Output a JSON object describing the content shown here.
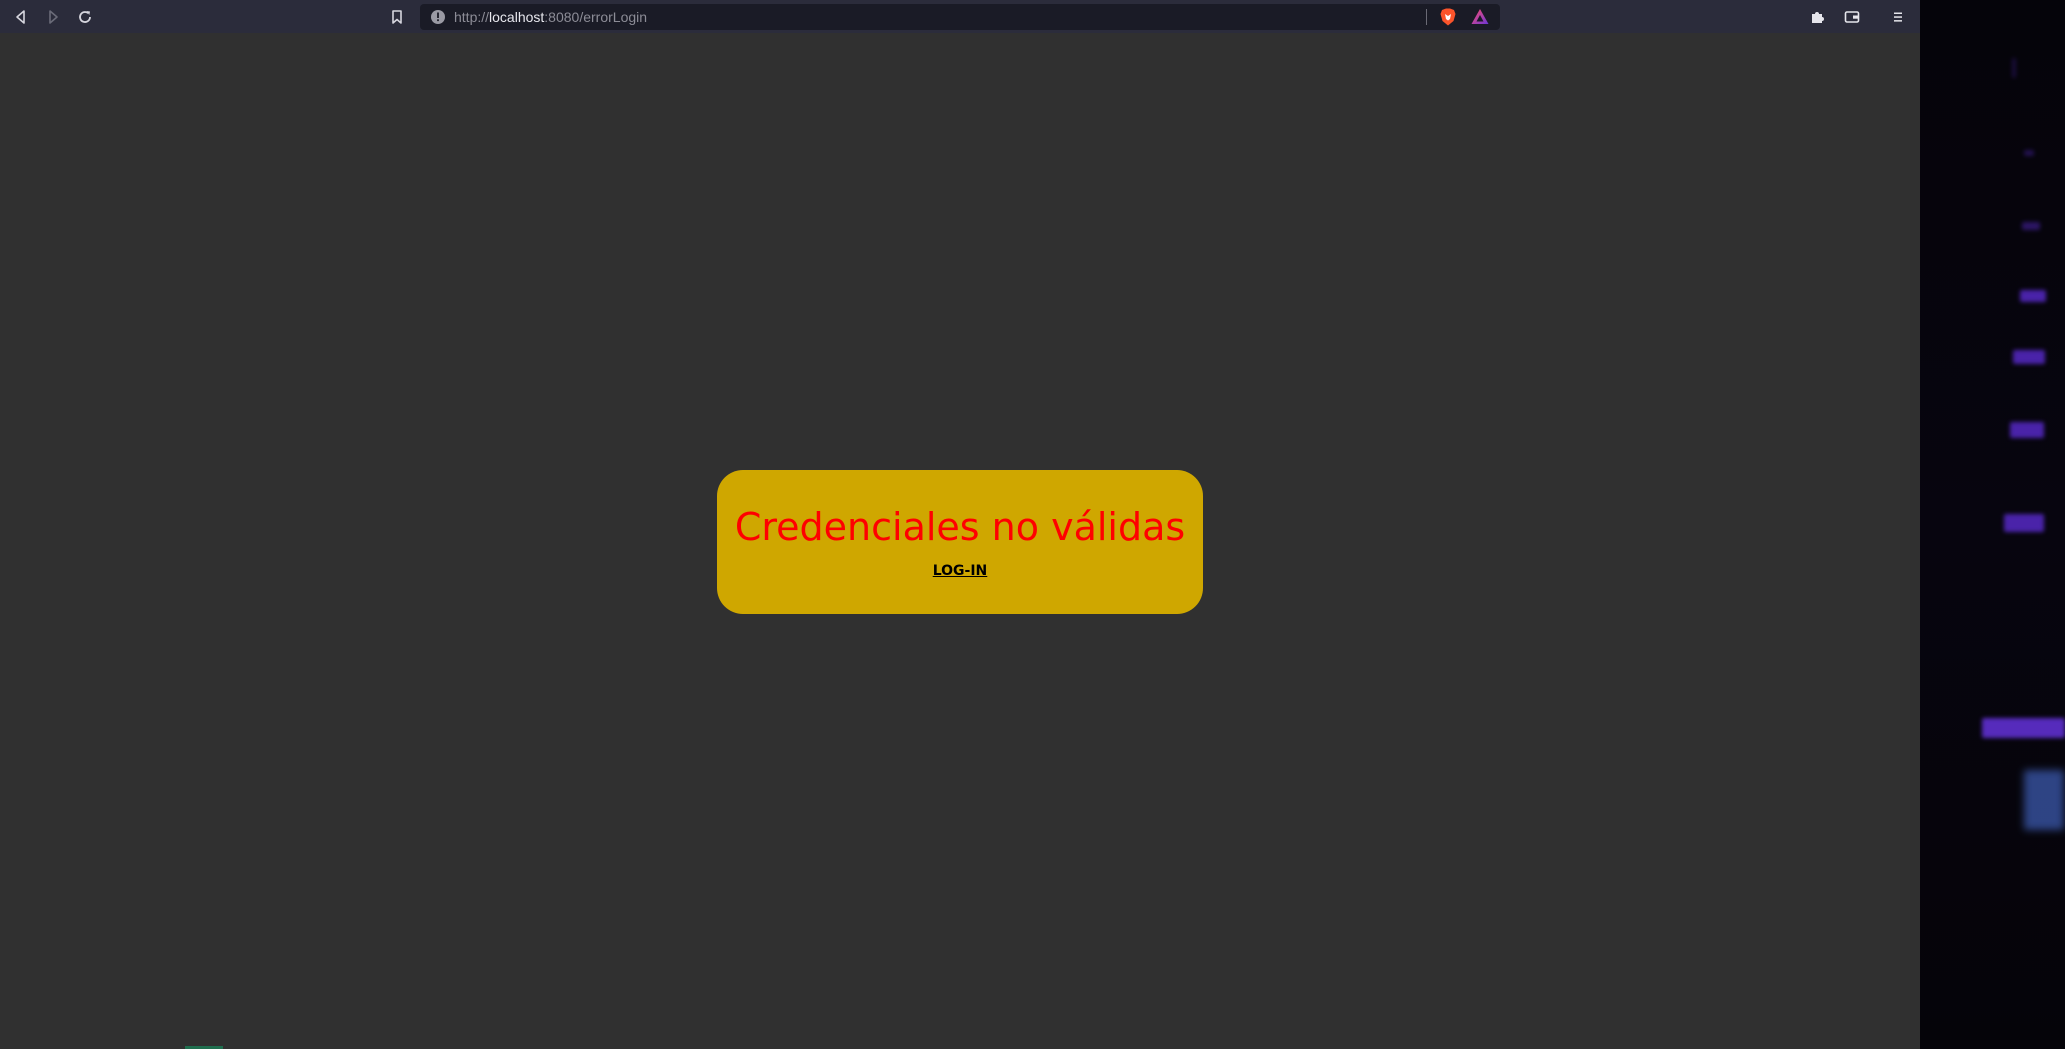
{
  "browser": {
    "url_scheme": "http://",
    "url_host": "localhost",
    "url_path": ":8080/errorLogin",
    "toolbar": {
      "back_icon": "back-arrow-icon",
      "forward_icon": "forward-arrow-icon",
      "reload_icon": "reload-icon",
      "bookmark_icon": "bookmark-icon",
      "site_info_icon": "info-icon",
      "brave_shields_icon": "brave-lion-icon",
      "rewards_icon": "rewards-triangle-icon",
      "extensions_icon": "puzzle-icon",
      "wallet_icon": "wallet-icon",
      "menu_icon": "hamburger-menu-icon"
    }
  },
  "error_card": {
    "title": "Credenciales no válidas",
    "login_link": "LOG-IN"
  },
  "colors": {
    "page_background": "#303030",
    "card_background": "#cfa700",
    "title_color": "#ff0000",
    "link_color": "#000000",
    "toolbar_background": "#2b2c3b"
  }
}
